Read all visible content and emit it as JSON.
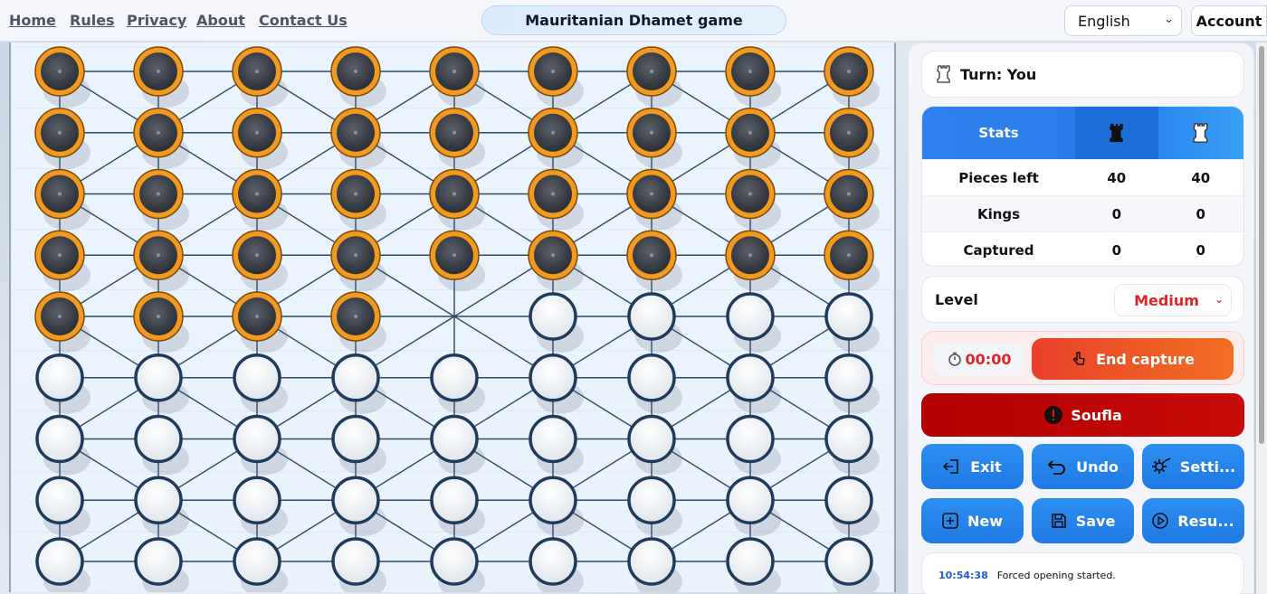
{
  "nav": {
    "home": "Home",
    "rules": "Rules",
    "privacy": "Privacy",
    "about": "About",
    "contact": "Contact Us"
  },
  "title": "Mauritanian Dhamet game",
  "language": {
    "selected": "English"
  },
  "account_label": "Account",
  "turn": {
    "text": "Turn: You"
  },
  "stats": {
    "header": "Stats",
    "rows": [
      {
        "label": "Pieces left",
        "black": "40",
        "white": "40"
      },
      {
        "label": "Kings",
        "black": "0",
        "white": "0"
      },
      {
        "label": "Captured",
        "black": "0",
        "white": "0"
      }
    ]
  },
  "level": {
    "label": "Level",
    "selected": "Medium"
  },
  "timer": "00:00",
  "end_capture_label": "End capture",
  "soufla_label": "Soufla",
  "buttons": {
    "exit": "Exit",
    "undo": "Undo",
    "settings": "Setti...",
    "new": "New",
    "save": "Save",
    "resume": "Resu..."
  },
  "log": {
    "time": "10:54:38",
    "message": "Forced opening started."
  },
  "board": {
    "cols": 9,
    "rows": 9,
    "rows_layout": [
      "BBBBBBBBB",
      "BBBBBBBBB",
      "BBBBBBBBB",
      "BBBBBBBBB",
      "BBBB.WWWW",
      "WWWWWWWWW",
      "WWWWWWWWW",
      "WWWWWWWWW",
      "WWWWWWWWW"
    ]
  },
  "colors": {
    "black_piece": "#2b2f36",
    "black_ring": "#f29a1f",
    "white_piece": "#ffffff",
    "white_ring": "#1f3a5a",
    "line": "#2e4a68",
    "accent_blue": "#2b7de9",
    "danger": "#dc2626"
  }
}
